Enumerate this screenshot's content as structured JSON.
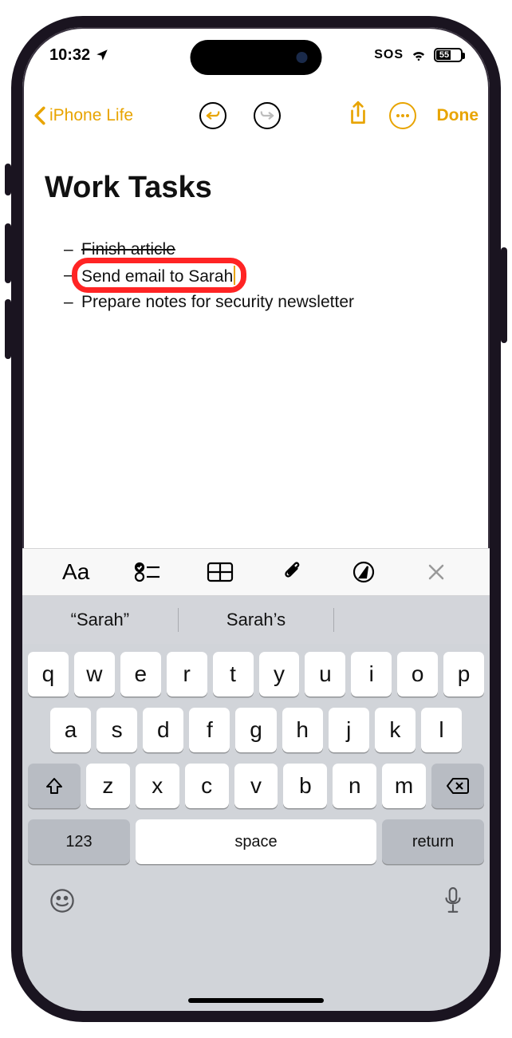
{
  "status": {
    "time": "10:32",
    "sos": "SOS",
    "battery_percent": "55",
    "battery_fill_pct": 55
  },
  "nav": {
    "back_label": "iPhone Life",
    "done_label": "Done"
  },
  "note": {
    "title": "Work Tasks",
    "items": [
      "Finish article",
      "Send email to Sarah",
      "Prepare notes for security newsletter"
    ]
  },
  "format_bar": {
    "aa": "Aa"
  },
  "suggestions": {
    "s1": "“Sarah”",
    "s2": "Sarah’s",
    "s3": ""
  },
  "keyboard": {
    "row1": [
      "q",
      "w",
      "e",
      "r",
      "t",
      "y",
      "u",
      "i",
      "o",
      "p"
    ],
    "row2": [
      "a",
      "s",
      "d",
      "f",
      "g",
      "h",
      "j",
      "k",
      "l"
    ],
    "row3": [
      "z",
      "x",
      "c",
      "v",
      "b",
      "n",
      "m"
    ],
    "num": "123",
    "space": "space",
    "return": "return"
  }
}
